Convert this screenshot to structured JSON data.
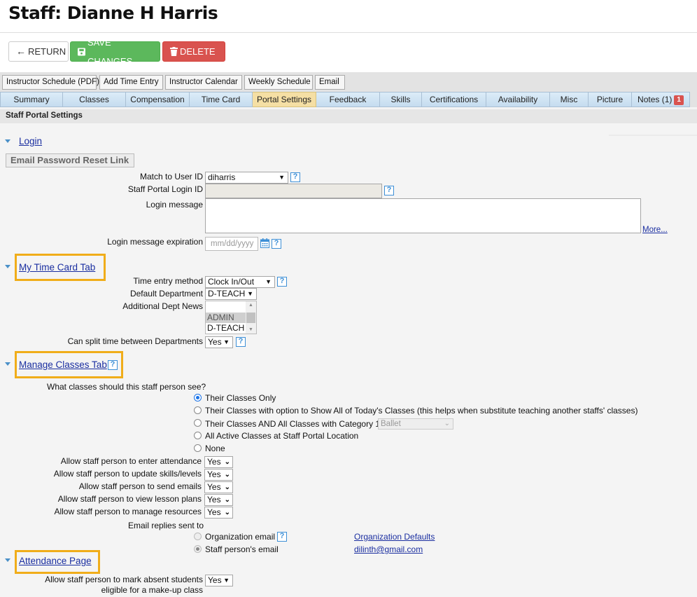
{
  "page": {
    "title": "Staff: Dianne H Harris"
  },
  "actions": {
    "return_label": "RETURN",
    "save_label": "SAVE CHANGES",
    "delete_label": "DELETE"
  },
  "toolbar": {
    "buttons": [
      "Instructor Schedule (PDF)",
      "Add Time Entry",
      "Instructor Calendar",
      "Weekly Schedule",
      "Email"
    ]
  },
  "tabs": {
    "items": [
      "Summary",
      "Classes",
      "Compensation",
      "Time Card",
      "Portal Settings",
      "Feedback",
      "Skills",
      "Certifications",
      "Availability",
      "Misc",
      "Picture",
      "Notes (1)"
    ],
    "active": "Portal Settings",
    "notes_badge": "1"
  },
  "section_title": "Staff Portal Settings",
  "login": {
    "heading": "Login",
    "email_reset_label": "Email Password Reset Link",
    "match_user_label": "Match to User ID",
    "match_user_value": "diharris",
    "portal_login_label": "Staff Portal Login ID",
    "portal_login_value": "",
    "login_message_label": "Login message",
    "login_message_value": "",
    "more_link": "More...",
    "expiration_label": "Login message expiration",
    "expiration_placeholder": "mm/dd/yyyy"
  },
  "time_card": {
    "heading": "My Time Card Tab",
    "entry_method_label": "Time entry method",
    "entry_method_value": "Clock In/Out",
    "default_dept_label": "Default Department",
    "default_dept_value": "D-TEACH",
    "additional_dept_label": "Additional Dept News",
    "additional_dept_options": [
      "",
      "ADMIN",
      "D-TEACH"
    ],
    "split_time_label": "Can split time between Departments",
    "split_time_value": "Yes"
  },
  "manage_classes": {
    "heading": "Manage Classes Tab",
    "question": "What classes should this staff person see?",
    "options": [
      "Their Classes Only",
      "Their Classes with option to Show All of Today's Classes (this helps when substitute teaching another staffs' classes)",
      "Their Classes AND All Classes with Category 1:",
      "All Active Classes at Staff Portal Location",
      "None"
    ],
    "selected_index": 0,
    "category_value": "Ballet",
    "permissions": [
      {
        "label": "Allow staff person to enter attendance",
        "value": "Yes"
      },
      {
        "label": "Allow staff person to update skills/levels",
        "value": "Yes"
      },
      {
        "label": "Allow staff person to send emails",
        "value": "Yes"
      },
      {
        "label": "Allow staff person to view lesson plans",
        "value": "Yes"
      },
      {
        "label": "Allow staff person to manage resources",
        "value": "Yes"
      }
    ],
    "email_replies_label": "Email replies sent to",
    "email_options": [
      "Organization email",
      "Staff person's email"
    ],
    "email_selected_index": 1,
    "org_defaults_link": "Organization Defaults",
    "staff_email": "dilinth@gmail.com"
  },
  "attendance": {
    "heading": "Attendance Page",
    "makeup_label_line1": "Allow staff person to mark absent students",
    "makeup_label_line2": "eligible for a make-up class",
    "makeup_value": "Yes"
  },
  "colors": {
    "save": "#5cb85c",
    "delete": "#d9534f",
    "active_tab": "#f5dfa4",
    "highlight_box": "#f0ad1a",
    "link": "#1a2ea0",
    "help_icon": "#3d8fd6"
  }
}
